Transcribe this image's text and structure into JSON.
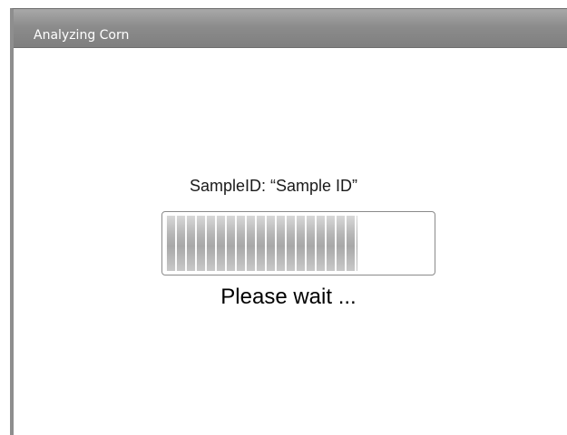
{
  "window": {
    "title": "Analyzing Corn"
  },
  "dialog": {
    "sample_label": "SampleID:",
    "sample_value": "“Sample ID”",
    "status": "Please wait ...",
    "progress_fraction": 0.72
  }
}
